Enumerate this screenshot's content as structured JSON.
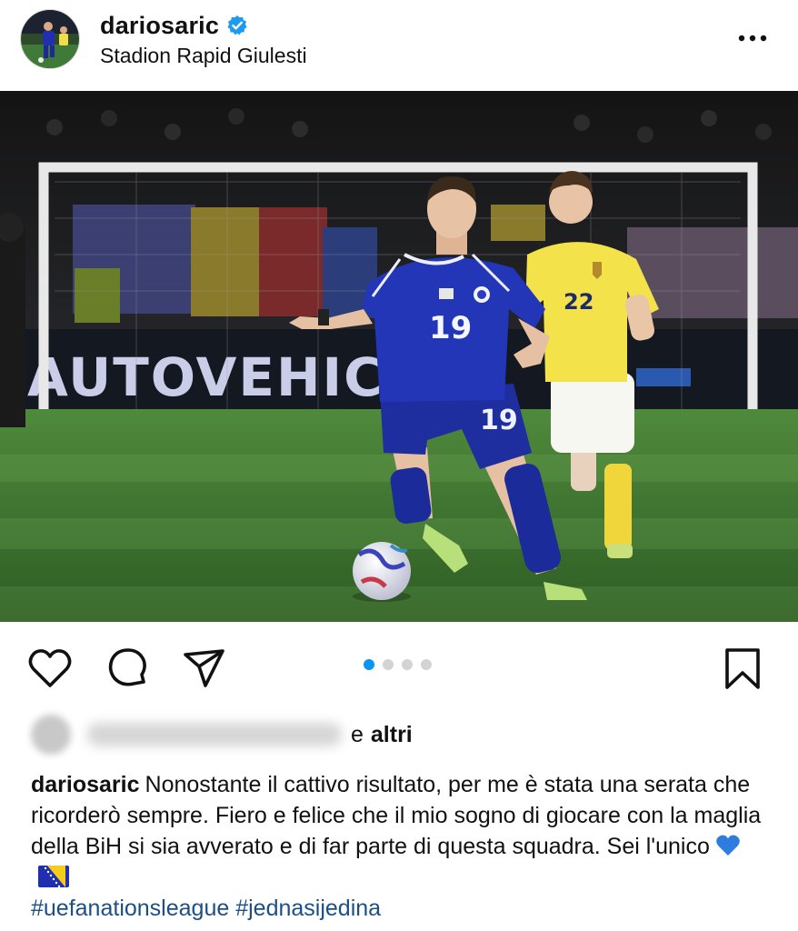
{
  "post": {
    "username": "dariosaric",
    "location": "Stadion Rapid Giulesti",
    "photo_text": {
      "ad_board": "AUTOVEHICULE",
      "player_number": "19",
      "opponent_number": "22"
    },
    "carousel": {
      "total": 4,
      "active": 1
    },
    "likes": {
      "and_text": "e",
      "others_text": "altri"
    },
    "caption": {
      "username": "dariosaric",
      "text": "Nonostante il cattivo risultato, per me è stata una serata che ricorderò sempre. Fiero e felice che il mio sogno di giocare con la maglia della BiH si sia avverato e di far parte di questa squadra. Sei l'unico",
      "emojis": [
        "blue-heart",
        "bosnia-flag"
      ],
      "hashtags": [
        "#uefanationsleague",
        "#jednasijedina"
      ]
    }
  },
  "colors": {
    "accent": "#0a95f0",
    "verified": "#1d9bf0",
    "hashtag": "#1b4f86",
    "bosnia_blue": "#1f2fb0",
    "romania_yellow": "#f3e24a"
  },
  "icons": [
    "verified-badge-icon",
    "more-options-icon",
    "heart-icon",
    "comment-icon",
    "share-icon",
    "bookmark-icon"
  ]
}
